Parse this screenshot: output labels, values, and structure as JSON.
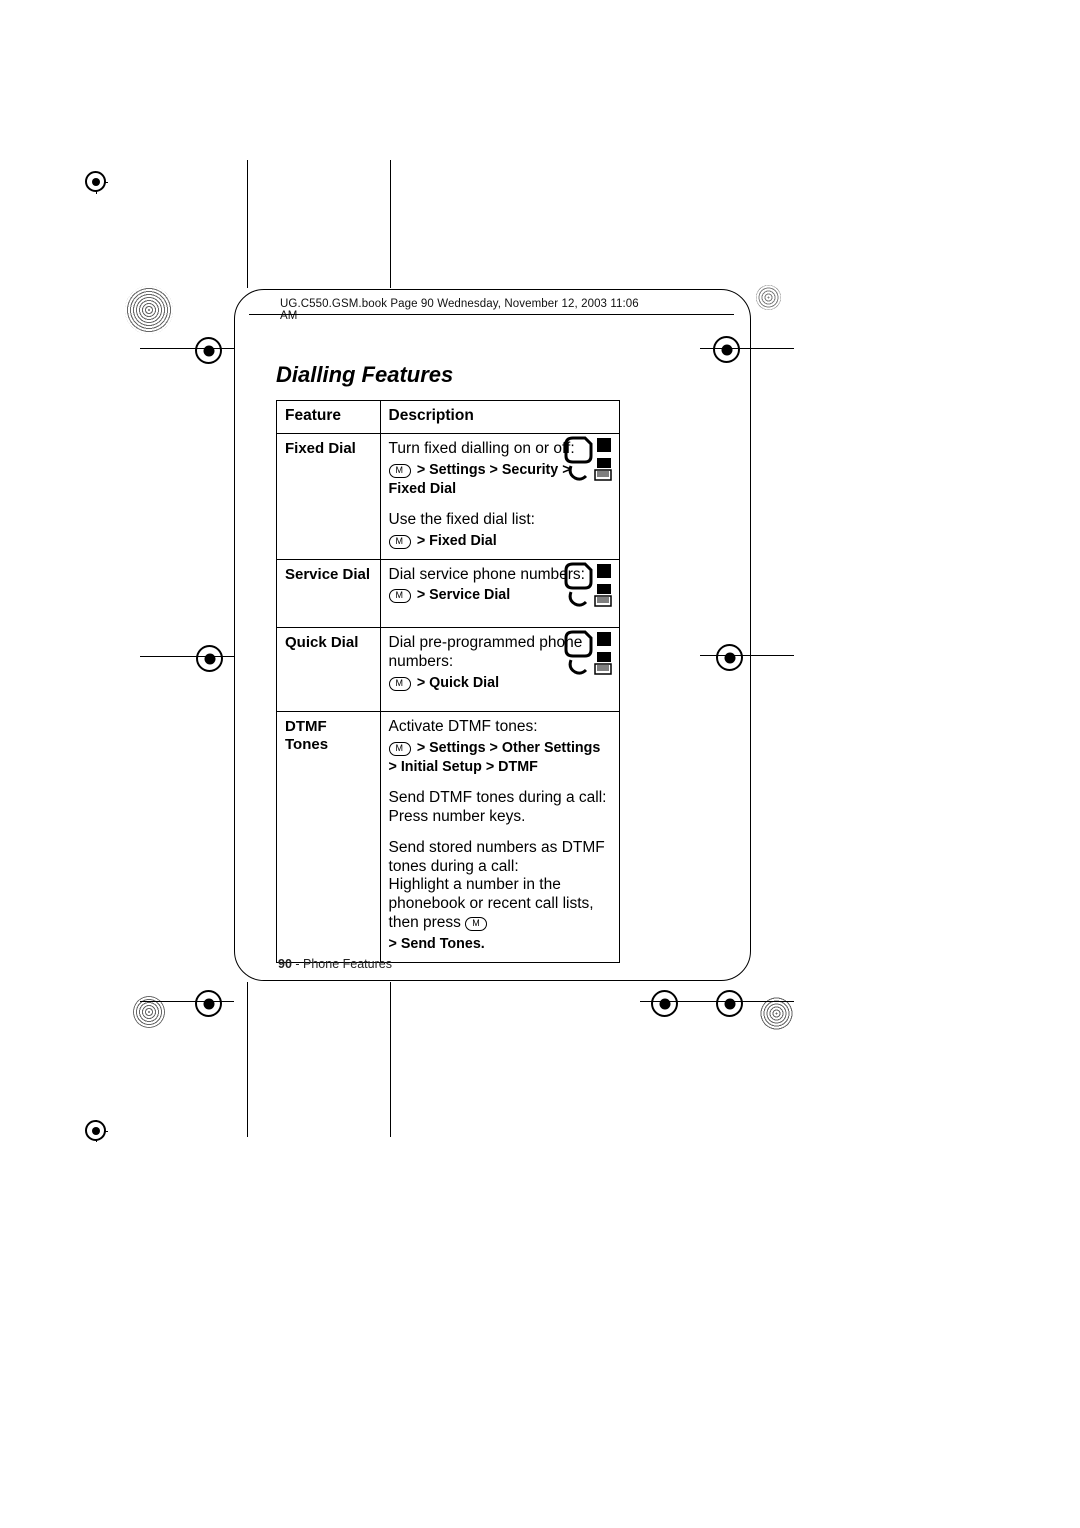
{
  "header_line": "UG.C550.GSM.book  Page 90  Wednesday, November 12, 2003  11:06 AM",
  "title": "Dialling Features",
  "table": {
    "head": {
      "feature": "Feature",
      "description": "Description"
    },
    "rows": [
      {
        "feature": "Fixed Dial",
        "lines": [
          {
            "text": "Turn fixed dialling on or off:",
            "menu": "> Settings > Security > Fixed Dial"
          },
          {
            "text": "Use the fixed dial list:",
            "menu": "> Fixed Dial"
          }
        ]
      },
      {
        "feature": "Service Dial",
        "lines": [
          {
            "text": "Dial service phone numbers:",
            "menu": "> Service Dial"
          }
        ]
      },
      {
        "feature": "Quick Dial",
        "lines": [
          {
            "text": "Dial pre-programmed phone numbers:",
            "menu": "> Quick Dial"
          }
        ]
      },
      {
        "feature": "DTMF Tones",
        "lines": [
          {
            "text": "Activate DTMF tones:",
            "menu": "> Settings > Other Settings > Initial Setup > DTMF"
          },
          {
            "text": "Send DTMF tones during a call: Press number keys."
          },
          {
            "text": "Send stored numbers as DTMF tones during a call:\nHighlight a number in the phonebook or recent call lists, then press",
            "trailing_glyph": true,
            "menu_last": "> Send Tones."
          }
        ]
      }
    ]
  },
  "footer": {
    "pagenum": "90",
    "section": " - Phone Features"
  },
  "glyph_label": "M"
}
